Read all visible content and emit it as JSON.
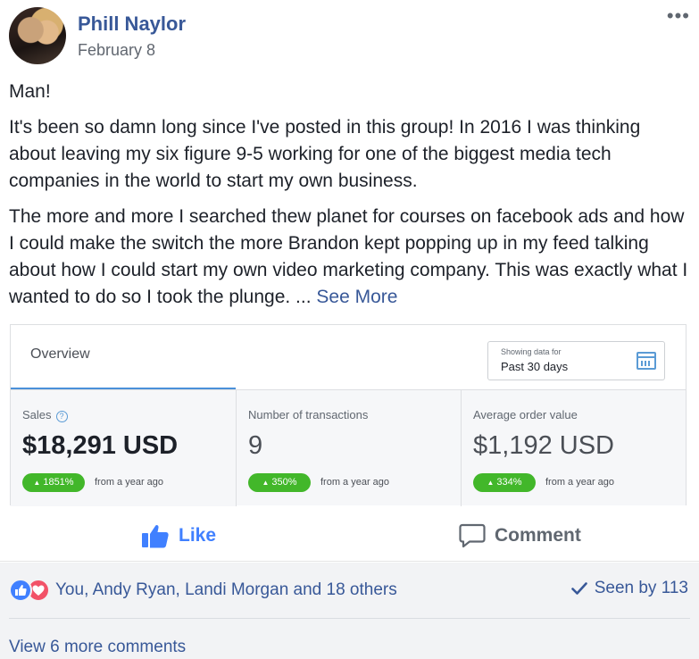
{
  "post": {
    "author": "Phill Naylor",
    "date": "February 8",
    "paragraphs": [
      "Man!",
      "It's been so damn long since I've posted in this group! In 2016 I was thinking about leaving my six figure 9-5 working for one of the biggest media tech companies in the world to start my own business.",
      "The more and more I searched thew planet for courses on facebook ads and how I could make the switch the more Brandon kept popping up in my feed talking about how I could start my own video marketing company. This was exactly what I wanted to do so I took the plunge. ..."
    ],
    "see_more": "See More"
  },
  "card": {
    "tab_label": "Overview",
    "date_caption": "Showing data for",
    "date_value": "Past 30 days",
    "metrics": [
      {
        "label": "Sales",
        "value": "$18,291 USD",
        "badge": "1851%",
        "from": "from a year ago"
      },
      {
        "label": "Number of transactions",
        "value": "9",
        "badge": "350%",
        "from": "from a year ago"
      },
      {
        "label": "Average order value",
        "value": "$1,192 USD",
        "badge": "334%",
        "from": "from a year ago"
      }
    ]
  },
  "actions": {
    "like": "Like",
    "comment": "Comment"
  },
  "reactions": {
    "text": "You, Andy Ryan, Landi Morgan and 18 others",
    "seen": "Seen by 113",
    "view_more": "View 6 more comments"
  },
  "colors": {
    "link": "#385898",
    "like_blue": "#4080ff",
    "badge_green": "#42b72a",
    "love_red": "#f25268"
  },
  "icons": [
    "more-dots-icon",
    "help-icon",
    "calendar-icon",
    "like-icon",
    "comment-icon",
    "like-reaction-icon",
    "love-reaction-icon",
    "check-icon"
  ]
}
